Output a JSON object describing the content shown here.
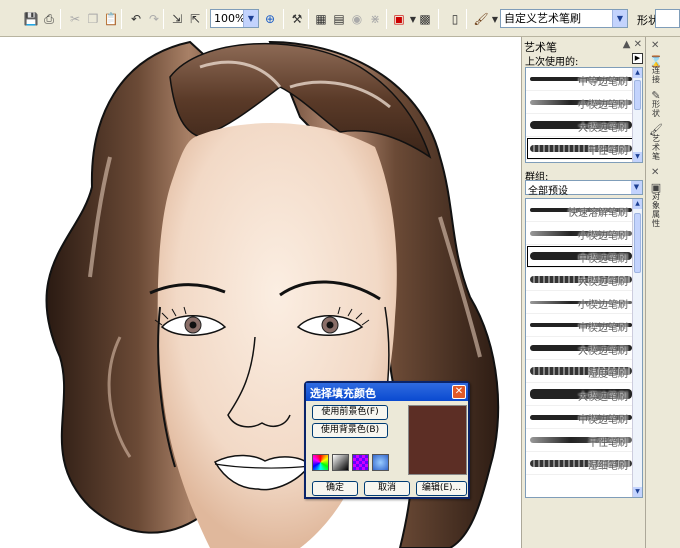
{
  "toolbar": {
    "zoom": "100%",
    "brush_preset": "自定义艺术笔刷",
    "shape_label": "形状"
  },
  "docker": {
    "title": "艺术笔",
    "recent_label": "上次使用的:",
    "recent": [
      {
        "name": "中等边笔刷"
      },
      {
        "name": "小楔边笔刷"
      },
      {
        "name": "大楔边笔刷"
      },
      {
        "name": "干性笔刷"
      }
    ],
    "group_label": "群组:",
    "group_value": "全部预设",
    "presets": [
      {
        "name": "快速溶解笔刷"
      },
      {
        "name": "小楔边笔刷"
      },
      {
        "name": "中楔边笔刷"
      },
      {
        "name": "大楔边笔刷"
      },
      {
        "name": "小楔边笔刷"
      },
      {
        "name": "中楔边笔刷"
      },
      {
        "name": "大楔边笔刷"
      },
      {
        "name": "湿度笔刷"
      },
      {
        "name": "大楔边笔刷"
      },
      {
        "name": "中楔边笔刷"
      },
      {
        "name": "干性笔刷"
      },
      {
        "name": "湿细笔刷"
      }
    ]
  },
  "tabs": [
    {
      "label": "连接"
    },
    {
      "label": "形状"
    },
    {
      "label": "艺术笔"
    },
    {
      "label": "对象属性"
    }
  ],
  "dialog": {
    "title": "选择填充颜色",
    "use_fg": "使用前景色(F)",
    "use_bg": "使用背景色(B)",
    "ok": "确定",
    "cancel": "取消",
    "edit": "编辑(E)...",
    "swatch_color": "#5c2e25"
  }
}
